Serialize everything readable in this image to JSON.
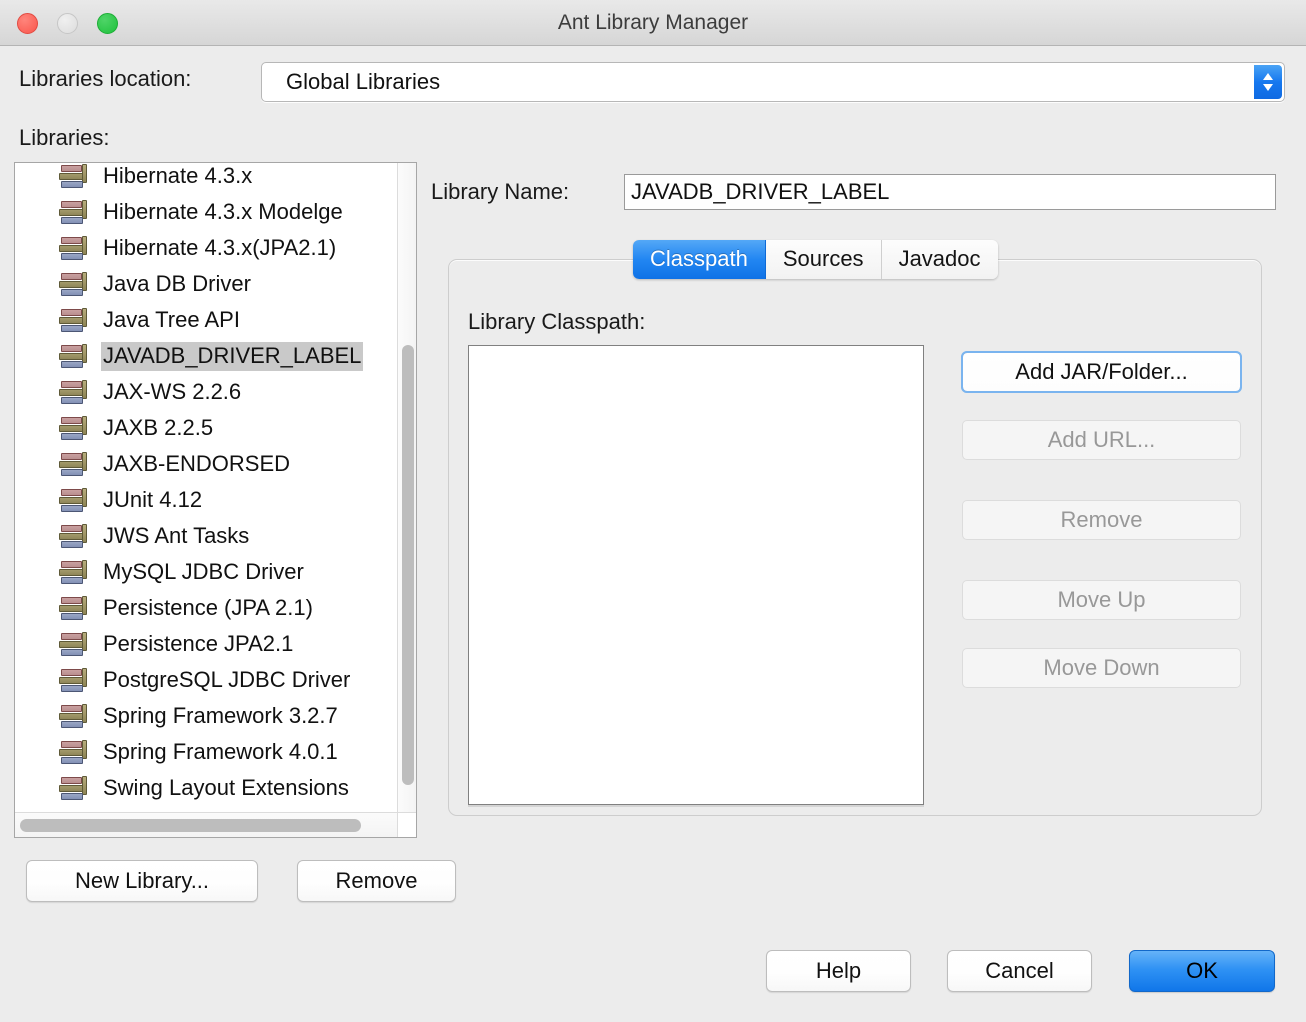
{
  "window": {
    "title": "Ant Library Manager",
    "traffic_lights": [
      "close",
      "minimize",
      "maximize"
    ]
  },
  "location_row": {
    "label": "Libraries location:",
    "selected_value": "Global Libraries",
    "options": [
      "Global Libraries"
    ]
  },
  "libraries_section": {
    "label": "Libraries:",
    "selected_item": "JAVADB_DRIVER_LABEL",
    "items": [
      "Hibernate 4.3.x",
      "Hibernate 4.3.x Modelge",
      "Hibernate 4.3.x(JPA2.1)",
      "Java DB Driver",
      "Java Tree API",
      "JAVADB_DRIVER_LABEL",
      "JAX-WS 2.2.6",
      "JAXB 2.2.5",
      "JAXB-ENDORSED",
      "JUnit 4.12",
      "JWS Ant Tasks",
      "MySQL JDBC Driver",
      "Persistence (JPA 2.1)",
      "Persistence JPA2.1",
      "PostgreSQL JDBC Driver",
      "Spring Framework 3.2.7",
      "Spring Framework 4.0.1",
      "Swing Layout Extensions"
    ]
  },
  "detail": {
    "name_label": "Library Name:",
    "name_value": "JAVADB_DRIVER_LABEL",
    "tabs": [
      {
        "label": "Classpath",
        "active": true
      },
      {
        "label": "Sources",
        "active": false
      },
      {
        "label": "Javadoc",
        "active": false
      }
    ],
    "classpath_label": "Library Classpath:",
    "classpath_entries": [],
    "side_buttons": [
      {
        "label": "Add JAR/Folder...",
        "enabled": true
      },
      {
        "label": "Add URL...",
        "enabled": false
      },
      {
        "label": "Remove",
        "enabled": false
      },
      {
        "label": "Move Up",
        "enabled": false
      },
      {
        "label": "Move Down",
        "enabled": false
      }
    ]
  },
  "footer": {
    "new_library": "New Library...",
    "remove": "Remove",
    "help": "Help",
    "cancel": "Cancel",
    "ok": "OK"
  },
  "colors": {
    "accent_blue": "#1f86f0",
    "window_bg": "#ececec",
    "selection_gray": "#c9c9c9",
    "disabled_text": "#989898"
  }
}
